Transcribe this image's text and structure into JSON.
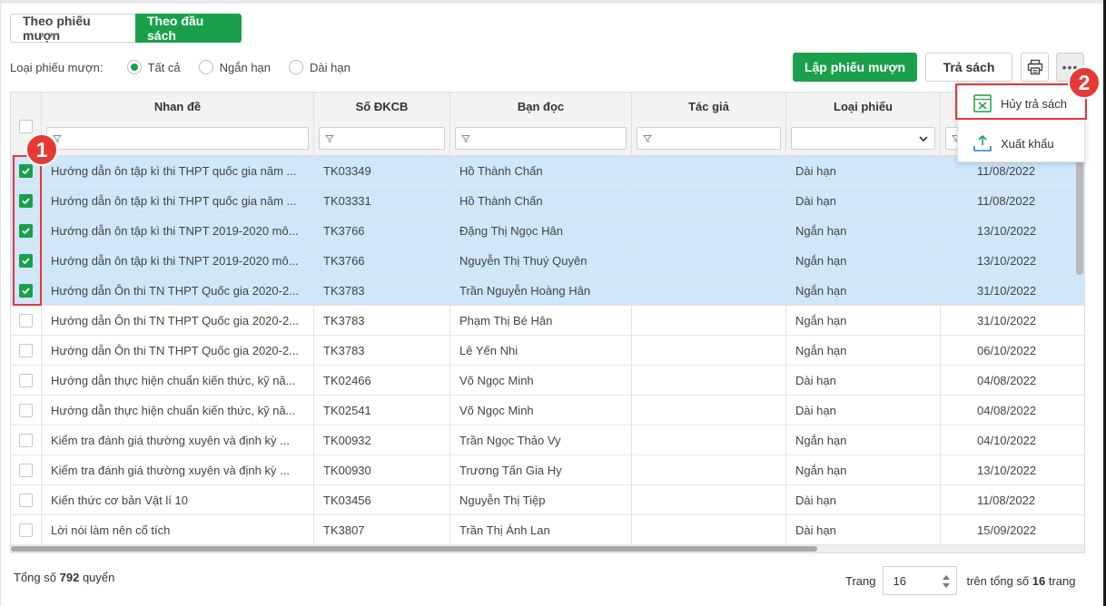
{
  "tabs": [
    {
      "label": "Theo phiếu mượn",
      "active": false
    },
    {
      "label": "Theo đầu sách",
      "active": true
    }
  ],
  "filter": {
    "label": "Loại phiếu mượn:",
    "options": [
      {
        "label": "Tất cả",
        "checked": true
      },
      {
        "label": "Ngắn hạn",
        "checked": false
      },
      {
        "label": "Dài hạn",
        "checked": false
      }
    ]
  },
  "toolbar": {
    "create_label": "Lập phiếu mượn",
    "return_label": "Trả sách",
    "print_icon": "printer-icon",
    "more_label": "•••"
  },
  "menu": {
    "items": [
      {
        "label": "Hủy trả sách",
        "icon": "cancel-return-icon"
      },
      {
        "label": "Xuất khẩu",
        "icon": "export-icon"
      }
    ]
  },
  "annotations": {
    "badge1": "1",
    "badge2": "2"
  },
  "table": {
    "columns": [
      "Nhan đề",
      "Số ĐKCB",
      "Bạn đọc",
      "Tác giả",
      "Loại phiếu",
      ""
    ],
    "rows": [
      {
        "title": "Hướng dẫn ôn tập kì thi THPT quốc gia năm ...",
        "code": "TK03349",
        "reader": "Hồ Thành Chấn",
        "author": "",
        "type": "Dài hạn",
        "date": "11/08/2022",
        "selected": true
      },
      {
        "title": "Hướng dẫn ôn tập kì thi THPT quốc gia năm ...",
        "code": "TK03331",
        "reader": "Hồ Thành Chấn",
        "author": "",
        "type": "Dài hạn",
        "date": "11/08/2022",
        "selected": true
      },
      {
        "title": "Hướng dẫn ôn tập kì thi TNPT 2019-2020 mô...",
        "code": "TK3766",
        "reader": "Đặng Thị Ngọc Hân",
        "author": "",
        "type": "Ngắn hạn",
        "date": "13/10/2022",
        "selected": true
      },
      {
        "title": "Hướng dẫn ôn tập kì thi TNPT 2019-2020 mô...",
        "code": "TK3766",
        "reader": "Nguyễn Thị Thuý Quyên",
        "author": "",
        "type": "Ngắn hạn",
        "date": "13/10/2022",
        "selected": true
      },
      {
        "title": "Hướng dẫn Ôn thi TN THPT Quốc gia 2020-2...",
        "code": "TK3783",
        "reader": "Trần Nguyễn Hoàng Hân",
        "author": "",
        "type": "Ngắn hạn",
        "date": "31/10/2022",
        "selected": true
      },
      {
        "title": "Hướng dẫn Ôn thi TN THPT Quốc gia 2020-2...",
        "code": "TK3783",
        "reader": "Phạm Thị Bé Hân",
        "author": "",
        "type": "Ngắn hạn",
        "date": "31/10/2022",
        "selected": false
      },
      {
        "title": "Hướng dẫn Ôn thi TN THPT Quốc gia 2020-2...",
        "code": "TK3783",
        "reader": "Lê Yến Nhi",
        "author": "",
        "type": "Ngắn hạn",
        "date": "06/10/2022",
        "selected": false
      },
      {
        "title": "Hướng dẫn thực hiện chuẩn kiến thức, kỹ nă...",
        "code": "TK02466",
        "reader": "Võ Ngọc Minh",
        "author": "",
        "type": "Dài hạn",
        "date": "04/08/2022",
        "selected": false
      },
      {
        "title": "Hướng dẫn thực hiện chuẩn kiến thức, kỹ nă...",
        "code": "TK02541",
        "reader": "Võ Ngọc Minh",
        "author": "",
        "type": "Dài hạn",
        "date": "04/08/2022",
        "selected": false
      },
      {
        "title": "Kiểm tra đánh giá thường xuyên và định kỳ ...",
        "code": "TK00932",
        "reader": "Trần Ngọc Thảo Vy",
        "author": "",
        "type": "Ngắn hạn",
        "date": "04/10/2022",
        "selected": false
      },
      {
        "title": "Kiểm tra đánh giá thường xuyên và định kỳ ...",
        "code": "TK00930",
        "reader": "Trương Tấn Gia Hy",
        "author": "",
        "type": "Ngắn hạn",
        "date": "13/10/2022",
        "selected": false
      },
      {
        "title": "Kiến thức cơ bản Vật lí 10",
        "code": "TK03456",
        "reader": "Nguyễn Thị Tiệp",
        "author": "",
        "type": "Dài hạn",
        "date": "11/08/2022",
        "selected": false
      },
      {
        "title": "Lời nói làm nên cổ tích",
        "code": "TK3807",
        "reader": "Trần Thị Ánh Lan",
        "author": "",
        "type": "Dài hạn",
        "date": "15/09/2022",
        "selected": false
      }
    ]
  },
  "footer": {
    "total_prefix": "Tổng số",
    "total_count": "792",
    "total_suffix": "quyển",
    "page_label": "Trang",
    "page_value": "16",
    "of_prefix": "trên tổng số",
    "page_total": "16",
    "of_suffix": "trang"
  },
  "colors": {
    "accent": "#1aa04a",
    "selected_row": "#cfe6fb",
    "annotation": "#e53935"
  }
}
